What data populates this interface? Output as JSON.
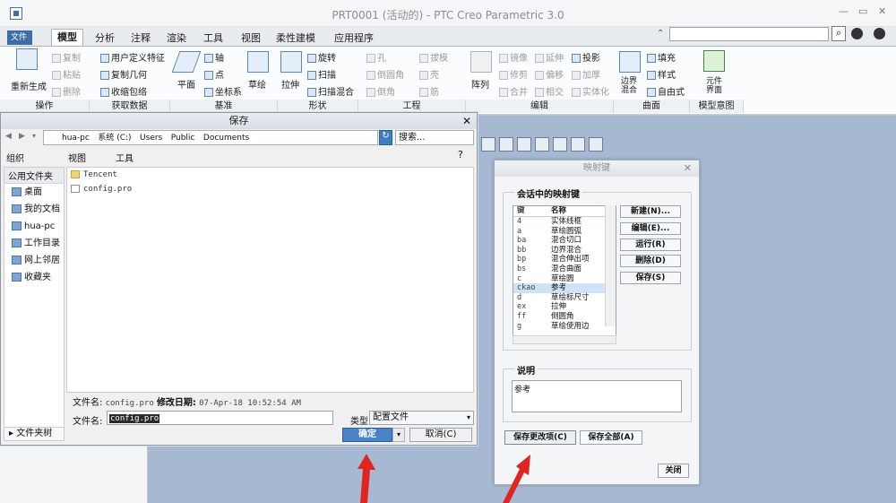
{
  "window": {
    "title": "PRT0001 (活动的) - PTC Creo Parametric 3.0",
    "minimize": "—",
    "restore": "▭",
    "close": "✕"
  },
  "tabs": [
    "文件",
    "模型",
    "分析",
    "注释",
    "渲染",
    "工具",
    "视图",
    "柔性建模",
    "应用程序"
  ],
  "ribbon": {
    "regen": "重新生成",
    "copy": "复制",
    "paste": "粘贴",
    "delete": "删除",
    "udf": "用户定义特征",
    "copygeom": "复制几何",
    "shrinkwrap": "收缩包络",
    "plane": "平面",
    "axis": "轴",
    "point": "点",
    "csys": "坐标系",
    "sketch": "草绘",
    "extrude": "拉伸",
    "revolve": "旋转",
    "sweep": "扫描",
    "sweepblend": "扫描混合",
    "hole": "孔",
    "round": "倒圆角",
    "chamfer": "倒角",
    "draft": "拔模",
    "shell": "壳",
    "rib": "筋",
    "pattern": "阵列",
    "mirror": "镜像",
    "extend": "延伸",
    "project": "投影",
    "trim": "修剪",
    "offset": "偏移",
    "thicken": "加厚",
    "merge": "合并",
    "intersect": "相交",
    "solidify": "实体化",
    "boundary": "边界混合",
    "fill": "填充",
    "style": "样式",
    "freestyle": "自由式",
    "component": "元件界面",
    "groups": [
      "操作",
      "获取数据",
      "基准",
      "形状",
      "工程",
      "编辑",
      "曲面",
      "模型意图"
    ]
  },
  "save": {
    "title": "保存",
    "path": [
      "hua-pc",
      "系统 (C:)",
      "Users",
      "Public",
      "Documents"
    ],
    "search_placeholder": "搜索...",
    "toolbar": {
      "organize": "组织",
      "view": "视图",
      "tools": "工具"
    },
    "places_header": "公用文件夹",
    "places": [
      "桌面",
      "我的文档",
      "hua-pc",
      "工作目录",
      "网上邻居",
      "收藏夹"
    ],
    "folder_tree": "文件夹树",
    "files": [
      "Tencent",
      "config.pro"
    ],
    "info_name_label": "文件名:",
    "info_name": "config.pro",
    "info_date_label": "修改日期:",
    "info_date": "07-Apr-18 10:52:54 AM",
    "filename_label": "文件名:",
    "filename": "config.pro",
    "type_label": "类型",
    "type": "配置文件",
    "ok": "确定",
    "cancel": "取消(C)"
  },
  "mapkeys": {
    "title": "映射键",
    "section": "会话中的映射键",
    "col_key": "键",
    "col_name": "名称",
    "rows": [
      {
        "k": "4",
        "n": "实体线框"
      },
      {
        "k": "a",
        "n": "草绘圆弧"
      },
      {
        "k": "ba",
        "n": "混合切口"
      },
      {
        "k": "bb",
        "n": "边界混合"
      },
      {
        "k": "bp",
        "n": "混合伸出项"
      },
      {
        "k": "bs",
        "n": "混合曲面"
      },
      {
        "k": "c",
        "n": "草绘圆"
      },
      {
        "k": "ckao",
        "n": "参考"
      },
      {
        "k": "d",
        "n": "草绘标尺寸"
      },
      {
        "k": "ex",
        "n": "拉伸"
      },
      {
        "k": "ff",
        "n": "倒圆角"
      },
      {
        "k": "g",
        "n": "草绘使用边"
      }
    ],
    "selected_index": 7,
    "buttons": {
      "new": "新建(N)...",
      "edit": "编辑(E)...",
      "run": "运行(R)",
      "delete": "删除(D)",
      "save": "保存(S)"
    },
    "desc_section": "说明",
    "desc": "参考",
    "save_changed": "保存更改项(C)",
    "save_all": "保存全部(A)",
    "close": "关闭"
  }
}
